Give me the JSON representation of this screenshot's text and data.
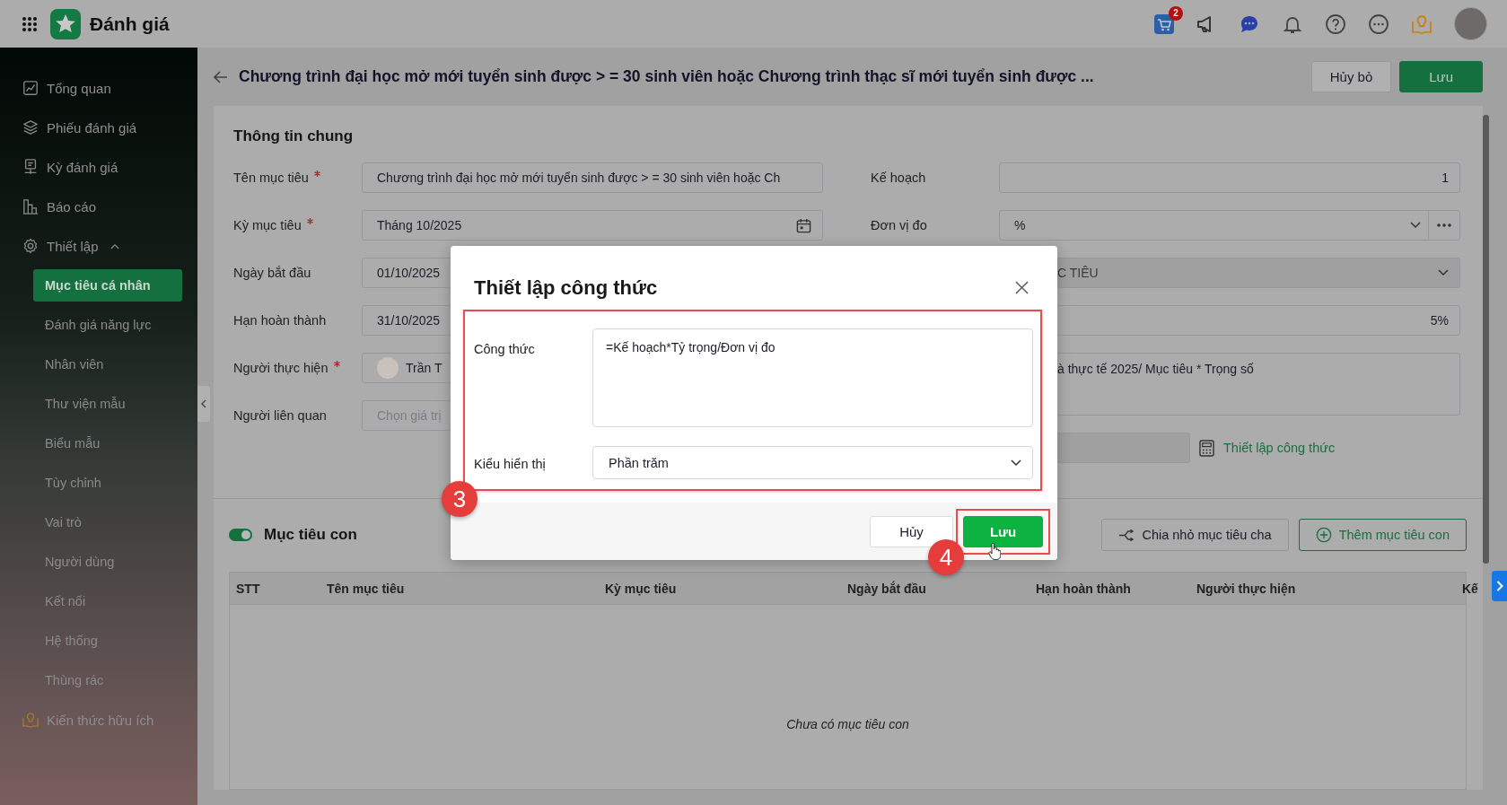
{
  "app": {
    "name": "Đánh giá",
    "cart_badge": "2"
  },
  "sidebar": {
    "items": [
      {
        "label": "Tổng quan",
        "selected": false
      },
      {
        "label": "Phiếu đánh giá",
        "selected": false
      },
      {
        "label": "Kỳ đánh giá",
        "selected": false
      },
      {
        "label": "Báo cáo",
        "selected": false
      },
      {
        "label": "Thiết lập",
        "selected": false,
        "expanded": true,
        "children": [
          {
            "label": "Mục tiêu cá nhân",
            "selected": true
          },
          {
            "label": "Đánh giá năng lực",
            "selected": false
          },
          {
            "label": "Nhân viên",
            "selected": false
          },
          {
            "label": "Thư viện mẫu",
            "selected": false
          },
          {
            "label": "Biểu mẫu",
            "selected": false
          },
          {
            "label": "Tùy chỉnh",
            "selected": false
          },
          {
            "label": "Vai trò",
            "selected": false
          },
          {
            "label": "Người dùng",
            "selected": false
          },
          {
            "label": "Kết nối",
            "selected": false
          },
          {
            "label": "Hệ thống",
            "selected": false
          },
          {
            "label": "Thùng rác",
            "selected": false
          }
        ]
      },
      {
        "label": "Kiến thức hữu ích",
        "selected": false
      }
    ]
  },
  "page": {
    "title": "Chương trình đại học mở mới tuyển sinh được > = 30 sinh viên hoặc Chương trình thạc sĩ mới tuyển sinh được ...",
    "buttons": [
      {
        "label": "Hủy bỏ",
        "kind": "secondary"
      },
      {
        "label": "Lưu",
        "kind": "primary"
      }
    ]
  },
  "general": {
    "heading": "Thông tin chung",
    "left_fields": [
      {
        "label": "Tên mục tiêu",
        "required": true,
        "kind": "text",
        "value": "Chương trình đại học mở mới tuyển sinh được > = 30 sinh viên hoặc Ch"
      },
      {
        "label": "Kỳ mục tiêu",
        "required": true,
        "kind": "date",
        "value": "Tháng 10/2025"
      },
      {
        "label": "Ngày bắt đầu",
        "required": false,
        "kind": "text",
        "value": "01/10/2025"
      },
      {
        "label": "Hạn hoàn thành",
        "required": false,
        "kind": "text",
        "value": "31/10/2025"
      },
      {
        "label": "Người thực hiện",
        "required": true,
        "kind": "person",
        "value": "Trần T"
      },
      {
        "label": "Người liên quan",
        "required": false,
        "kind": "text",
        "placeholder": "Chọn giá trị"
      }
    ],
    "right_fields": [
      {
        "label": "Kế hoạch",
        "kind": "number",
        "disabled": false,
        "value": "1"
      },
      {
        "label": "Đơn vị đo",
        "kind": "select-more",
        "disabled": false,
        "value": "%"
      },
      {
        "kind": "select",
        "disabled": true,
        "value": "C TIÊU"
      },
      {
        "kind": "number",
        "disabled": false,
        "value": "5%"
      },
      {
        "kind": "textarea",
        "disabled": false,
        "value": "à thực tế 2025/ Mục tiêu * Trọng số"
      },
      {
        "kind": "formula",
        "disabled": true,
        "link": "Thiết lập công thức"
      }
    ]
  },
  "subgoals": {
    "heading": "Mục tiêu con",
    "on": true,
    "buttons": [
      {
        "label": "Chia nhỏ mục tiêu cha",
        "kind": "split"
      },
      {
        "label": "Thêm mục tiêu con",
        "kind": "add"
      }
    ],
    "table": {
      "columns": [
        "STT",
        "Tên mục tiêu",
        "Kỳ mục tiêu",
        "Ngày bắt đầu",
        "Hạn hoàn thành",
        "Người thực hiện",
        "Kế"
      ],
      "empty_text": "Chưa có mục tiêu con"
    }
  },
  "dialog": {
    "title": "Thiết lập công thức",
    "fields": [
      {
        "label": "Công thức",
        "kind": "textarea",
        "value": "=Kế hoạch*Tỷ trọng/Đơn vị đo"
      },
      {
        "label": "Kiểu hiển thị",
        "kind": "select",
        "value": "Phần trăm"
      }
    ],
    "buttons": [
      {
        "label": "Hủy",
        "kind": "secondary"
      },
      {
        "label": "Lưu",
        "kind": "primary"
      }
    ]
  },
  "annotations": [
    {
      "label": "3"
    },
    {
      "label": "4"
    }
  ]
}
